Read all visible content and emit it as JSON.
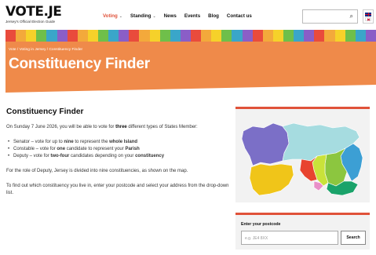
{
  "brand": {
    "logo_text": "VOTE.JE",
    "tagline": "Jersey's Official Election Guide"
  },
  "nav": {
    "items": [
      {
        "label": "Voting",
        "has_dropdown": true,
        "active": true
      },
      {
        "label": "Standing",
        "has_dropdown": true,
        "active": false
      },
      {
        "label": "News",
        "has_dropdown": false,
        "active": false
      },
      {
        "label": "Events",
        "has_dropdown": false,
        "active": false
      },
      {
        "label": "Blog",
        "has_dropdown": false,
        "active": false
      },
      {
        "label": "Contact us",
        "has_dropdown": false,
        "active": false
      }
    ],
    "dropdown_icon": "chevron-down-icon"
  },
  "header_search": {
    "placeholder": "",
    "icon": "search-icon"
  },
  "language": {
    "icons": [
      "uk-flag-icon",
      "jersey-flag-icon"
    ]
  },
  "stripe_colors": [
    "#e94b3c",
    "#f3a93b",
    "#f6d12a",
    "#6fbf4a",
    "#3aa6c9",
    "#8a5ec7",
    "#e94b3c",
    "#f3a93b",
    "#f6d12a",
    "#6fbf4a",
    "#3aa6c9",
    "#8a5ec7",
    "#e94b3c",
    "#f3a93b",
    "#f6d12a",
    "#6fbf4a",
    "#3aa6c9",
    "#8a5ec7",
    "#e94b3c",
    "#f3a93b",
    "#f6d12a",
    "#6fbf4a",
    "#3aa6c9",
    "#8a5ec7",
    "#e94b3c",
    "#f3a93b",
    "#f6d12a",
    "#6fbf4a",
    "#3aa6c9",
    "#8a5ec7",
    "#e94b3c",
    "#f3a93b",
    "#f6d12a",
    "#6fbf4a",
    "#3aa6c9",
    "#8a5ec7"
  ],
  "hero": {
    "breadcrumb": "Vote / Voting in Jersey / Constituency Finder",
    "title": "Constituency Finder",
    "background": "#ef8a4a"
  },
  "main": {
    "heading": "Constituency Finder",
    "intro_part1": "On Sunday 7 June 2026, you will be able to vote for ",
    "intro_bold": "three",
    "intro_part2": " different types of States Member:",
    "list": [
      {
        "pre": "Senator – vote for up to ",
        "b1": "nine",
        "mid": " to represent the ",
        "b2": "whole Island"
      },
      {
        "pre": "Constable – vote for ",
        "b1": "one",
        "mid": " candidate to represent your ",
        "b2": "Parish"
      },
      {
        "pre": "Deputy – vote for ",
        "b1": "two-four",
        "mid": " candidates depending on your ",
        "b2": "constituency"
      }
    ],
    "para2": "For the role of Deputy, Jersey is divided into nine constituencies, as shown on the map.",
    "para3": "To find out which constituency you live in, enter your postcode and select your address from the drop-down list."
  },
  "map": {
    "accent": "#e0523a",
    "regions": [
      {
        "name": "north-west",
        "color": "#7b6fc7"
      },
      {
        "name": "north-east",
        "color": "#a6dce0"
      },
      {
        "name": "west",
        "color": "#f0c519"
      },
      {
        "name": "central",
        "color": "#8cc63f"
      },
      {
        "name": "south-central",
        "color": "#e8432f"
      },
      {
        "name": "east",
        "color": "#3c9fd4"
      },
      {
        "name": "south-east",
        "color": "#1aa36a"
      },
      {
        "name": "south",
        "color": "#c9e23a"
      },
      {
        "name": "town",
        "color": "#e98fc8"
      }
    ]
  },
  "postcode": {
    "label": "Enter your postcode",
    "placeholder": "e.g. JE4 8XX",
    "button": "Search"
  }
}
